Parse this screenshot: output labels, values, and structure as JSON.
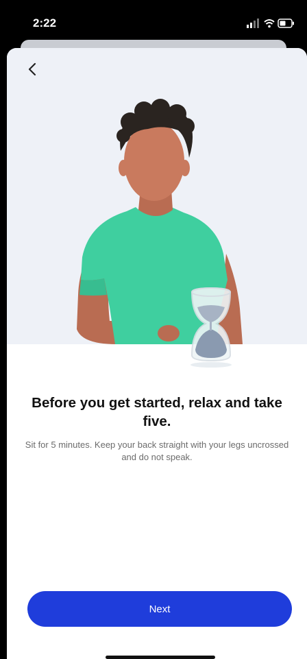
{
  "status_bar": {
    "time": "2:22",
    "icons": [
      "signal-icon",
      "wifi-icon",
      "battery-icon"
    ]
  },
  "nav": {
    "back_icon": "chevron-left-icon"
  },
  "content": {
    "title": "Before you get started, relax and take five.",
    "subtitle": "Sit for 5 minutes. Keep your back straight with your legs uncrossed and do not speak."
  },
  "actions": {
    "next_label": "Next"
  },
  "colors": {
    "primary": "#1f3ddb",
    "hero_background": "#eef1f7",
    "shirt": "#3fcf9f",
    "skin": "#c97a5e",
    "hair": "#2a2420",
    "sand": "#a7b3c4"
  }
}
